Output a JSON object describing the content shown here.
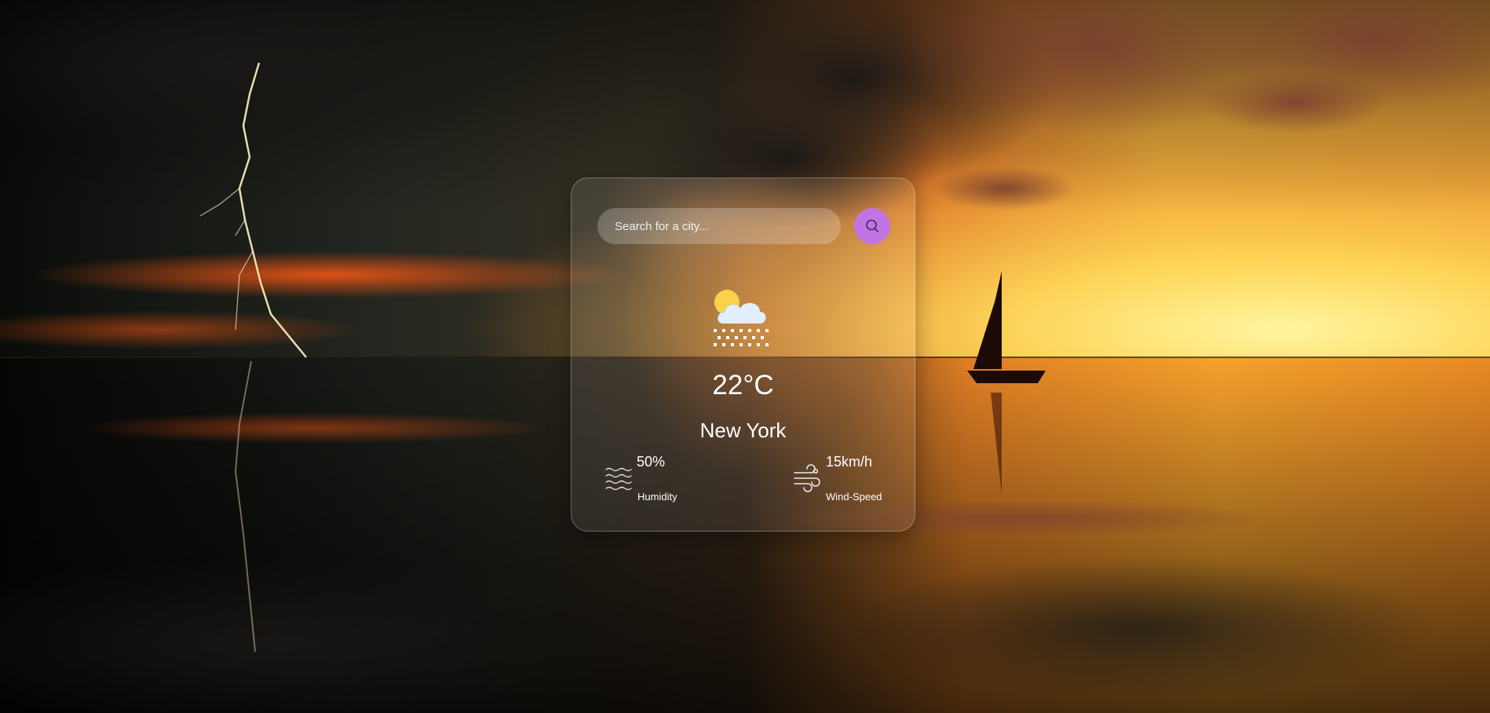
{
  "search": {
    "placeholder": "Search for a city...",
    "value": "",
    "button_icon": "search-icon"
  },
  "weather": {
    "icon": "cloud-sun-snow-icon",
    "temperature": "22°C",
    "city": "New York"
  },
  "stats": {
    "humidity": {
      "icon": "humidity-waves-icon",
      "value": "50%",
      "label": "Humidity"
    },
    "wind": {
      "icon": "wind-icon",
      "value": "15km/h",
      "label": "Wind-Speed"
    }
  },
  "colors": {
    "search_button": "#c175e2",
    "text": "#ffffff"
  }
}
